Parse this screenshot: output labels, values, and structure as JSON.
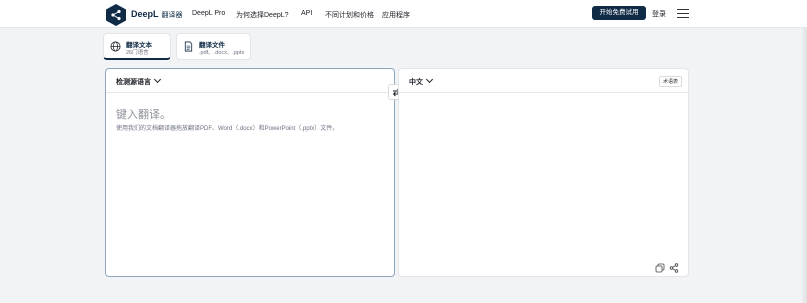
{
  "header": {
    "brand_name": "DeepL",
    "brand_sub": "翻译器",
    "nav": [
      "DeepL Pro",
      "为何选择DeepL?",
      "API",
      "不同计划和价格",
      "应用程序"
    ],
    "cta_label": "开始免费试用",
    "login_label": "登录",
    "icons": [
      "deepl-logo-icon",
      "hamburger-menu-icon"
    ]
  },
  "tabs": [
    {
      "title": "翻译文本",
      "subtitle": "26门语言",
      "icon": "globe-icon",
      "active": true
    },
    {
      "title": "翻译文件",
      "subtitle": ".pdf、.docx、.pptx",
      "icon": "document-icon",
      "active": false
    }
  ],
  "source": {
    "language_label": "检测源语言",
    "placeholder": "键入翻译。",
    "hint": "使用我们的文档翻译器拖放翻译PDF、Word（.docx）和PowerPoint（.pptx）文件。"
  },
  "target": {
    "language_label": "中文",
    "glossary_label": "术语表"
  },
  "colors": {
    "brand": "#0f2b46",
    "background": "#f1f3f5",
    "active_border": "#8fa6be"
  }
}
